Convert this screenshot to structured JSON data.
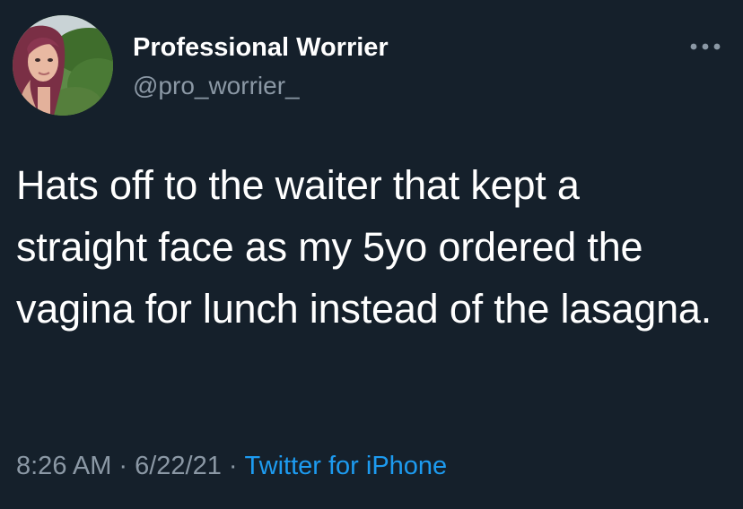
{
  "tweet": {
    "display_name": "Professional Worrier",
    "handle": "@pro_worrier_",
    "text": "Hats off to the waiter that kept a straight face as my 5yo ordered the vagina for lunch instead of the lasagna.",
    "time": "8:26 AM",
    "date": "6/22/21",
    "separator": "·",
    "source": "Twitter for iPhone"
  },
  "icons": {
    "more": "more-horizontal-icon",
    "avatar": "profile-photo"
  },
  "colors": {
    "background": "#15202b",
    "primary_text": "#ffffff",
    "secondary_text": "#8b98a5",
    "link": "#1d9bf0"
  }
}
